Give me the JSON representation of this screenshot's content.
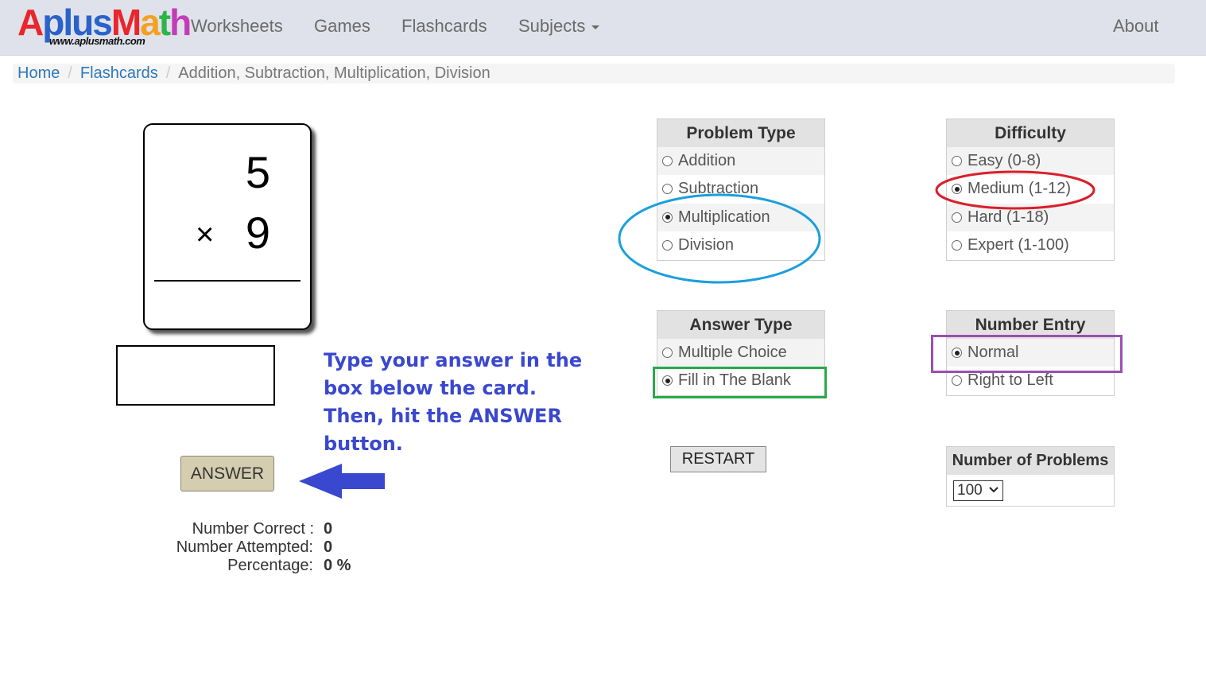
{
  "navbar": {
    "logo": {
      "text": "AplusMath",
      "url": "www.aplusmath.com"
    },
    "links": [
      "Worksheets",
      "Games",
      "Flashcards",
      "Subjects"
    ],
    "about": "About"
  },
  "breadcrumb": {
    "home": "Home",
    "flashcards": "Flashcards",
    "current": "Addition, Subtraction, Multiplication, Division",
    "separator": "/"
  },
  "card": {
    "top_number": "5",
    "operator": "×",
    "bottom_number": "9"
  },
  "answer_input": {
    "value": ""
  },
  "answer_button": "ANSWER",
  "instruction": {
    "lines": [
      "Type your answer in the",
      "box below the card.",
      "Then, hit the ANSWER",
      "button."
    ],
    "color": "#3a48cf"
  },
  "stats": [
    {
      "label": "Number Correct :",
      "value": "0"
    },
    {
      "label": "Number Attempted:",
      "value": "0"
    },
    {
      "label": "Percentage:",
      "value": "0 %"
    }
  ],
  "problem_type": {
    "title": "Problem Type",
    "options": [
      "Addition",
      "Subtraction",
      "Multiplication",
      "Division"
    ],
    "selected": "Multiplication"
  },
  "difficulty": {
    "title": "Difficulty",
    "options": [
      "Easy (0-8)",
      "Medium (1-12)",
      "Hard (1-18)",
      "Expert (1-100)"
    ],
    "selected": "Medium (1-12)"
  },
  "answer_type": {
    "title": "Answer Type",
    "options": [
      "Multiple Choice",
      "Fill in The Blank"
    ],
    "selected": "Fill in The Blank"
  },
  "number_entry": {
    "title": "Number Entry",
    "options": [
      "Normal",
      "Right to Left"
    ],
    "selected": "Normal"
  },
  "restart_button": "RESTART",
  "number_of_problems": {
    "title": "Number of Problems",
    "selected": "100"
  },
  "annotation_colors": {
    "blue_ellipse": "#1a9fdc",
    "red_ellipse": "#d9202a",
    "green_box": "#2ba84a",
    "purple_box": "#9b4fb0",
    "arrow": "#3a48cf"
  }
}
